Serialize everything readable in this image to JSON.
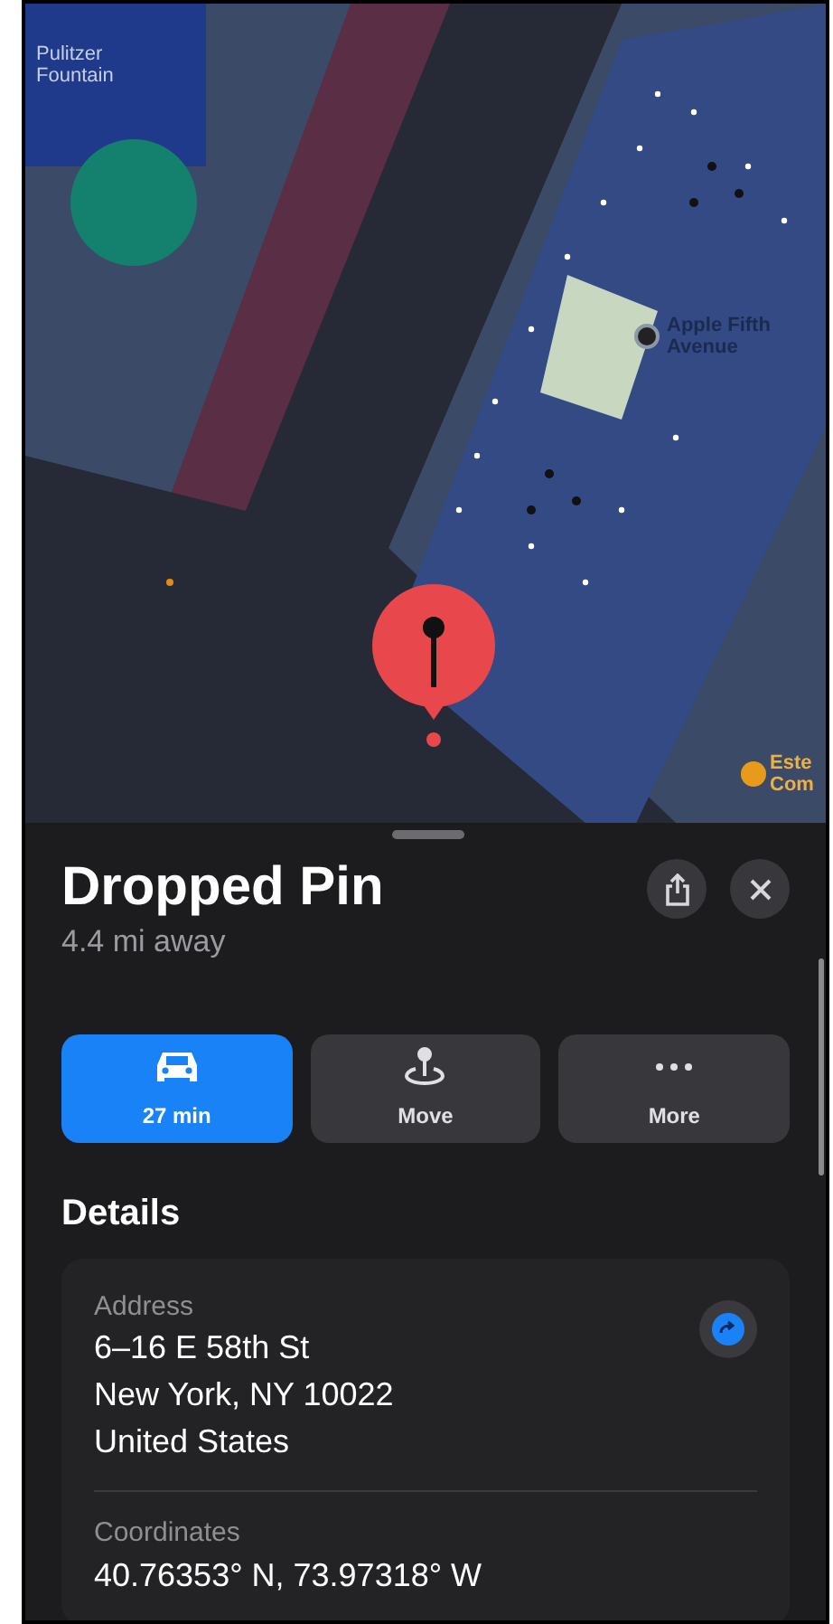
{
  "map": {
    "labels": [
      {
        "kind": "area",
        "text": "Pulitzer\nFountain"
      },
      {
        "kind": "store",
        "text": "Apple Fifth\nAvenue"
      },
      {
        "kind": "poi",
        "text": "Este\nCom"
      }
    ]
  },
  "sheet": {
    "title": "Dropped Pin",
    "subtitle": "4.4 mi away",
    "actions": [
      {
        "kind": "car",
        "label": "27 min",
        "selected": true
      },
      {
        "kind": "move",
        "label": "Move",
        "selected": false
      },
      {
        "kind": "more",
        "label": "More",
        "selected": false
      }
    ],
    "details_heading": "Details",
    "address": {
      "label": "Address",
      "lines": [
        "6–16 E 58th St",
        "New York, NY  10022",
        "United States"
      ]
    },
    "coordinates": {
      "label": "Coordinates",
      "value": "40.76353° N, 73.97318° W"
    }
  }
}
